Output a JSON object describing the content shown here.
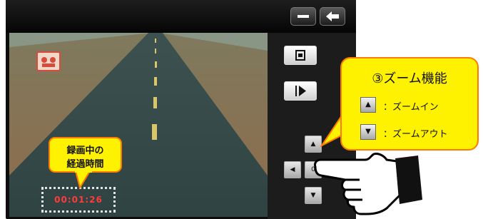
{
  "topbar": {
    "minimize_icon": "minus-icon",
    "back_icon": "back-arrow-icon"
  },
  "video": {
    "camera_icon": "camera-flip-icon",
    "elapsed_time": "00:01:26"
  },
  "side_buttons": {
    "snapshot_icon": "snapshot-icon",
    "playback_icon": "play-icon"
  },
  "dpad": {
    "up_glyph": "▲",
    "down_glyph": "▼",
    "left_glyph": "◀",
    "center_glyph": "0"
  },
  "annotations": {
    "recording_line1": "録画中の",
    "recording_line2": "経過時間",
    "zoom_title": "③ズーム機能",
    "zoom_in_glyph": "▲",
    "zoom_in_label": "：ズームイン",
    "zoom_out_glyph": "▼",
    "zoom_out_label": "：ズームアウト"
  },
  "colors": {
    "callout_fill": "#fff200",
    "callout_border": "#ff7a00",
    "timer_text": "#ff3b3b"
  }
}
